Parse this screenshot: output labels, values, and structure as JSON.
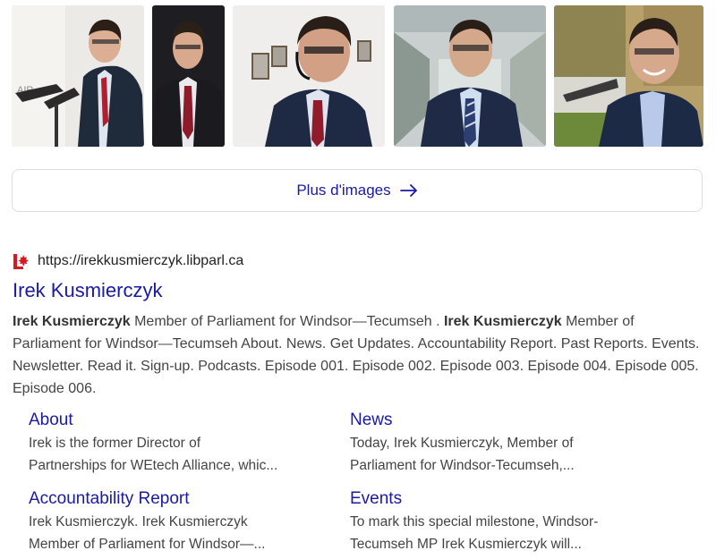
{
  "more_images": {
    "label": "Plus d'images"
  },
  "result": {
    "url": "https://irekkusmierczyk.libparl.ca",
    "title": "Irek Kusmierczyk",
    "snippet": [
      {
        "text": "Irek Kusmierczyk",
        "bold": true
      },
      {
        "text": " Member of Parliament for Windsor—Tecumseh . ",
        "bold": false
      },
      {
        "text": "Irek Kusmierczyk",
        "bold": true
      },
      {
        "text": " Member of Parliament for Windsor—Tecumseh About. News. Get Updates. Accountability Report. Past Reports. Events. Newsletter. Read it. Sign-up. Podcasts. Episode 001. Episode 002. Episode 003. Episode 004. Episode 005. Episode 006.",
        "bold": false
      }
    ]
  },
  "sitelinks": [
    {
      "title": "About",
      "desc1": "Irek is the former Director of",
      "desc2": "Partnerships for WEtech Alliance, whic..."
    },
    {
      "title": "News",
      "desc1": "Today, Irek Kusmierczyk, Member of",
      "desc2": "Parliament for Windsor-Tecumseh,..."
    },
    {
      "title": "Accountability Report",
      "desc1": "Irek Kusmierczyk. Irek Kusmierczyk",
      "desc2": "Member of Parliament for Windsor—..."
    },
    {
      "title": "Events",
      "desc1": "To mark this special milestone, Windsor-",
      "desc2": "Tecumseh MP Irek Kusmierczyk will..."
    }
  ],
  "colors": {
    "link": "#1a1aa6",
    "liberal_red": "#d71920"
  }
}
